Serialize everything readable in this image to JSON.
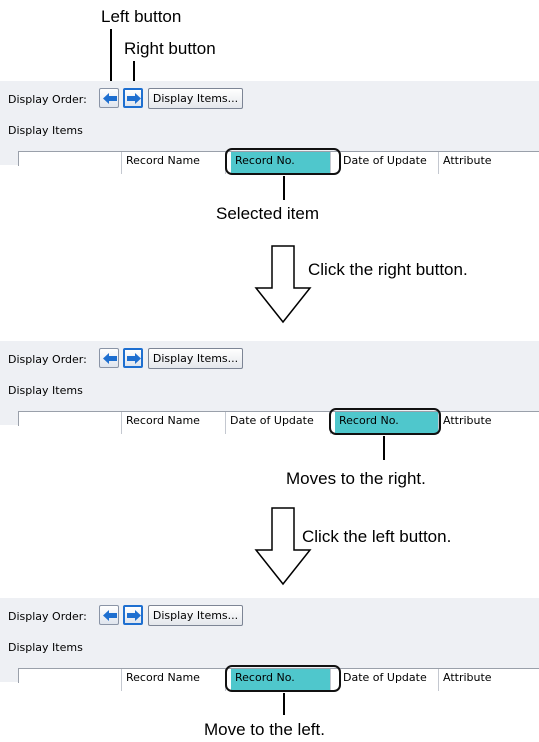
{
  "annotations": {
    "left_button": "Left button",
    "right_button": "Right button",
    "selected_item": "Selected item",
    "click_right": "Click the right button.",
    "moves_right": "Moves to the right.",
    "click_left": "Click the left button.",
    "move_left": "Move to the left."
  },
  "panel": {
    "display_order_label": "Display Order:",
    "display_items_label": "Display Items",
    "display_items_button": "Display Items...",
    "left_arrow_icon": "left-arrow-icon",
    "right_arrow_icon": "right-arrow-icon"
  },
  "panels": [
    {
      "columns": [
        "",
        "Record Name",
        "Record No.",
        "Date of Update",
        "Attribute"
      ],
      "selected": "Record No."
    },
    {
      "columns": [
        "",
        "Record Name",
        "Date of Update",
        "Record No.",
        "Attribute"
      ],
      "selected": "Record No."
    },
    {
      "columns": [
        "",
        "Record Name",
        "Record No.",
        "Date of Update",
        "Attribute"
      ],
      "selected": "Record No."
    }
  ],
  "colors": {
    "selected_cell": "#4fc7cc",
    "arrow_icon": "#1e6fd0"
  }
}
